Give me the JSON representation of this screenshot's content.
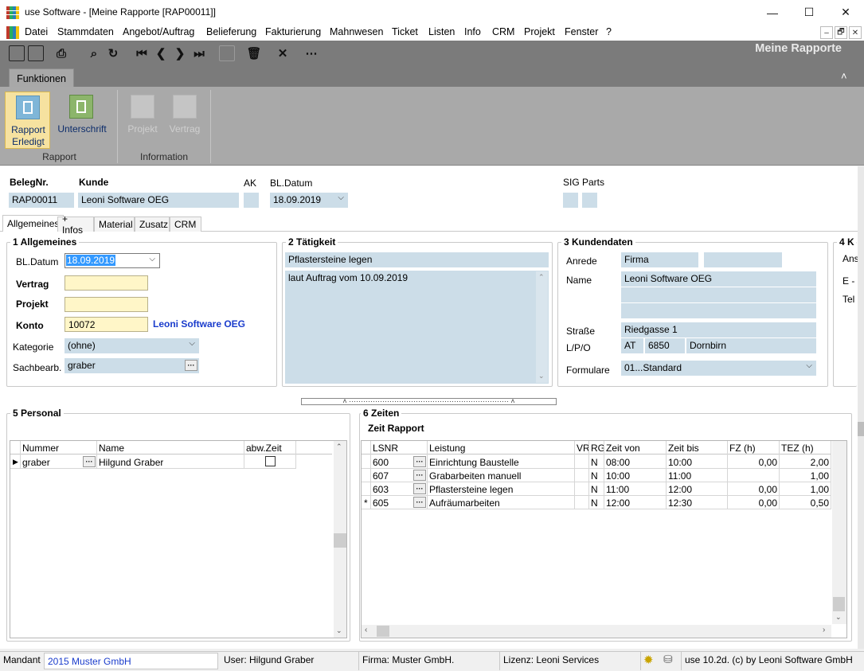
{
  "window": {
    "title": "use Software - [Meine Rapporte [RAP00011]]",
    "minimize": "—",
    "maximize": "☐",
    "close": "✕"
  },
  "menu": [
    "Datei",
    "Stammdaten",
    "Angebot/Auftrag",
    "Belieferung",
    "Fakturierung",
    "Mahnwesen",
    "Ticket",
    "Listen",
    "Info",
    "CRM",
    "Projekt",
    "Fenster",
    "?"
  ],
  "mdi_controls": [
    "–",
    "🗗",
    "✕"
  ],
  "toolbar": {
    "ribbon_title": "Meine Rapporte"
  },
  "ribbon": {
    "tab": "Funktionen",
    "collapse_icon": "˄",
    "groups": [
      {
        "label": "Rapport",
        "buttons": [
          "Rapport\nErledigt",
          "Unterschrift"
        ]
      },
      {
        "label": "Information",
        "buttons": [
          "Projekt",
          "Vertrag"
        ]
      }
    ]
  },
  "header": {
    "belegnr_label": "BelegNr.",
    "belegnr": "RAP00011",
    "kunde_label": "Kunde",
    "kunde": "Leoni Software OEG",
    "ak_label": "AK",
    "bldatum_label": "BL.Datum",
    "bldatum": "18.09.2019",
    "sig_label": "SIG",
    "parts_label": "Parts"
  },
  "tabs": [
    "Allgemeines",
    "+ Infos",
    "Material",
    "Zusatz",
    "CRM"
  ],
  "allgemeines": {
    "title": "1 Allgemeines",
    "bldatum_label": "BL.Datum",
    "bldatum": "18.09.2019",
    "vertrag_label": "Vertrag",
    "vertrag": "",
    "projekt_label": "Projekt",
    "projekt": "",
    "konto_label": "Konto",
    "konto": "10072",
    "konto_name": "Leoni Software OEG",
    "kategorie_label": "Kategorie",
    "kategorie": "(ohne)",
    "sachbearb_label": "Sachbearb.",
    "sachbearb": "graber"
  },
  "taetigkeit": {
    "title": "2 Tätigkeit",
    "summary": "Pflastersteine legen",
    "text": "laut Auftrag vom 10.09.2019"
  },
  "kundendaten": {
    "title": "3 Kundendaten",
    "anrede_label": "Anrede",
    "anrede": "Firma",
    "anrede2": "",
    "name_label": "Name",
    "name": "Leoni Software OEG",
    "strasse_label": "Straße",
    "strasse": "Riedgasse 1",
    "lpo_label": "L/P/O",
    "land": "AT",
    "plz": "6850",
    "ort": "Dornbirn",
    "formulare_label": "Formulare",
    "formulare": "01...Standard"
  },
  "panel4": {
    "title": "4 K",
    "labels": [
      "Ans",
      "E -",
      "Tel"
    ]
  },
  "personal": {
    "title": "5 Personal",
    "columns": [
      "Nummer",
      "Name",
      "abw.Zeit"
    ],
    "rows": [
      {
        "nummer": "graber",
        "name": "Hilgund Graber"
      }
    ]
  },
  "zeiten": {
    "title": "6 Zeiten",
    "subtitle": "Zeit Rapport",
    "columns": [
      "LSNR",
      "Leistung",
      "VR",
      "RG",
      "Zeit von",
      "Zeit bis",
      "FZ (h)",
      "TEZ (h)"
    ],
    "rows": [
      {
        "lsnr": "600",
        "leistung": "Einrichtung Baustelle",
        "vr": "",
        "rg": "N",
        "von": "08:00",
        "bis": "10:00",
        "fz": "0,00",
        "tez": "2,00"
      },
      {
        "lsnr": "607",
        "leistung": "Grabarbeiten manuell",
        "vr": "",
        "rg": "N",
        "von": "10:00",
        "bis": "11:00",
        "fz": "",
        "tez": "1,00"
      },
      {
        "lsnr": "603",
        "leistung": "Pflastersteine legen",
        "vr": "",
        "rg": "N",
        "von": "11:00",
        "bis": "12:00",
        "fz": "0,00",
        "tez": "1,00"
      },
      {
        "lsnr": "605",
        "leistung": "Aufräumarbeiten",
        "vr": "",
        "rg": "N",
        "von": "12:00",
        "bis": "12:30",
        "fz": "0,00",
        "tez": "0,50"
      }
    ],
    "new_row_marker": "*"
  },
  "status": {
    "mandant_label": "Mandant",
    "mandant": "2015 Muster GmbH",
    "user": "User: Hilgund Graber",
    "firma": "Firma: Muster GmbH.",
    "lizenz": "Lizenz: Leoni Services",
    "version": "use 10.2d. (c) by Leoni Software GmbH"
  }
}
